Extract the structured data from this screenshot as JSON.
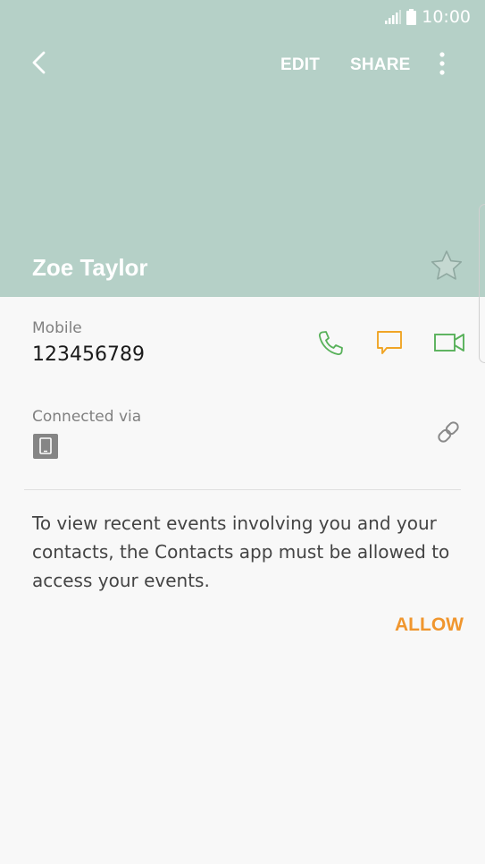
{
  "status_bar": {
    "time": "10:00",
    "signal_icon": "signal-icon",
    "battery_icon": "battery-icon"
  },
  "toolbar": {
    "back_icon": "back-arrow-icon",
    "edit_label": "EDIT",
    "share_label": "SHARE",
    "more_icon": "more-vert-icon"
  },
  "contact": {
    "name": "Zoe Taylor",
    "favorite_icon": "star-icon"
  },
  "mobile": {
    "label": "Mobile",
    "number": "123456789",
    "actions": {
      "call_icon": "phone-icon",
      "message_icon": "message-icon",
      "video_icon": "video-call-icon"
    }
  },
  "connected": {
    "label": "Connected via",
    "device_icon": "device-icon",
    "link_icon": "link-icon"
  },
  "events": {
    "message": "To view recent events involving you and your contacts, the Contacts app must be allowed to access your events.",
    "allow_label": "ALLOW"
  },
  "colors": {
    "header_bg": "#b5d0c7",
    "page_bg": "#f8f8f8",
    "call_green": "#58b15a",
    "message_orange": "#f0a526",
    "video_green": "#58b15a",
    "allow_orange": "#f0962e"
  }
}
